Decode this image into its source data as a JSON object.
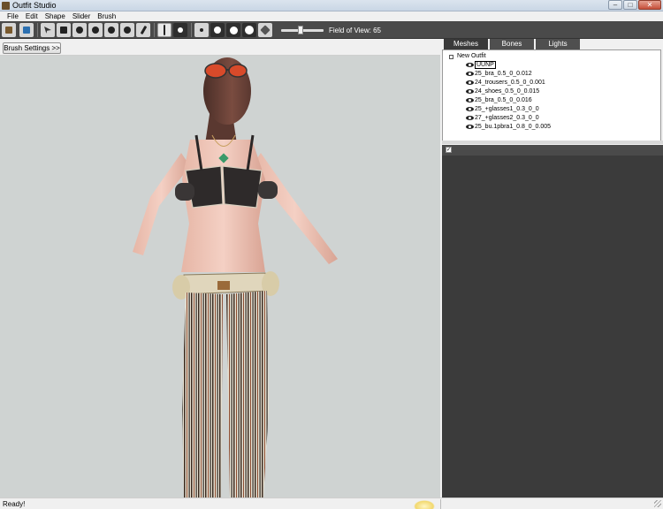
{
  "window": {
    "title": "Outfit Studio"
  },
  "menu": [
    "File",
    "Edit",
    "Shape",
    "Slider",
    "Brush"
  ],
  "toolbar": {
    "icons": [
      "save-project-icon",
      "import-icon",
      "select-brush-icon",
      "mask-brush-icon",
      "inflate-brush-icon",
      "deflate-brush-icon",
      "move-brush-icon",
      "smooth-brush-icon",
      "weight-brush-icon",
      "mirror-x-icon",
      "connected-only-icon",
      "dot-small-icon",
      "dot-medium-icon",
      "dot-large-icon",
      "dot-xlarge-icon",
      "cube-shaded-icon"
    ],
    "fov_label": "Field of View: 65",
    "fov_value": 65
  },
  "brush": {
    "settings_button": "Brush Settings >>"
  },
  "panel": {
    "tabs": [
      "Meshes",
      "Bones",
      "Lights"
    ],
    "tree": {
      "root": "New Outfit",
      "items": [
        {
          "label": "UUNP",
          "selected": true
        },
        {
          "label": "25_bra_0.5_0_0.012"
        },
        {
          "label": "24_trousers_0.5_0_0.001"
        },
        {
          "label": "24_shoes_0.5_0_0.015"
        },
        {
          "label": "25_bra_0.5_0_0.016"
        },
        {
          "label": "25_+glasses1_0.3_0_0"
        },
        {
          "label": "27_+glasses2_0.3_0_0"
        },
        {
          "label": "25_bu.1pbra1_0.8_0_0.005"
        }
      ]
    }
  },
  "status": {
    "text": "Ready!"
  }
}
